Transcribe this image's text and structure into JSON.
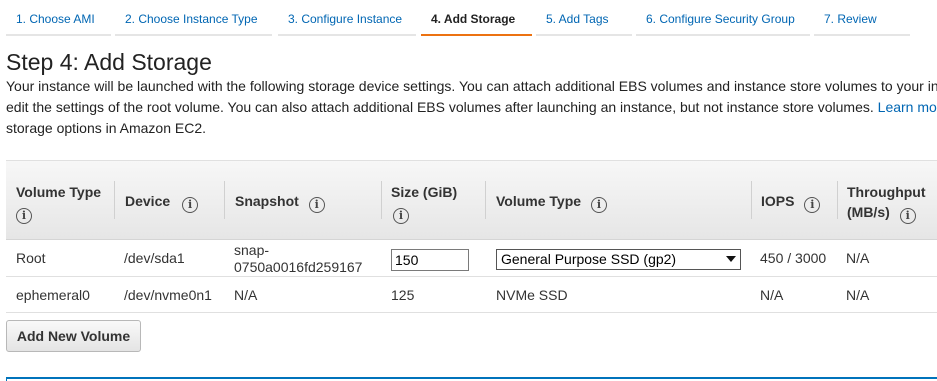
{
  "wizard": {
    "steps": [
      {
        "label": "1. Choose AMI"
      },
      {
        "label": "2. Choose Instance Type"
      },
      {
        "label": "3. Configure Instance"
      },
      {
        "label": "4. Add Storage"
      },
      {
        "label": "5. Add Tags"
      },
      {
        "label": "6. Configure Security Group"
      },
      {
        "label": "7. Review"
      }
    ],
    "active_step": "4. Add Storage"
  },
  "page": {
    "title": "Step 4: Add Storage",
    "description_line1": "Your instance will be launched with the following storage device settings. You can attach additional EBS volumes and instance store volumes to your in",
    "description_line2": "edit the settings of the root volume. You can also attach additional EBS volumes after launching an instance, but not instance store volumes. ",
    "learn_more": "Learn mo",
    "description_line3": "storage options in Amazon EC2."
  },
  "table": {
    "columns": [
      {
        "label_a": "Volume Type",
        "label_b": ""
      },
      {
        "label_a": "Device",
        "label_b": ""
      },
      {
        "label_a": "Snapshot",
        "label_b": ""
      },
      {
        "label_a": "Size (GiB)",
        "label_b": ""
      },
      {
        "label_a": "Volume Type",
        "label_b": ""
      },
      {
        "label_a": "IOPS",
        "label_b": ""
      },
      {
        "label_a": "Throughput",
        "label_b": "(MB/s)"
      }
    ],
    "rows": [
      {
        "volume_type": "Root",
        "device": "/dev/sda1",
        "snapshot_a": "snap-",
        "snapshot_b": "0750a0016fd259167",
        "size": "150",
        "ebs_type": "General Purpose SSD (gp2)",
        "iops": "450 / 3000",
        "throughput": "N/A"
      },
      {
        "volume_type": "ephemeral0",
        "device": "/dev/nvme0n1",
        "snapshot": "N/A",
        "size": "125",
        "ebs_type": "NVMe SSD",
        "iops": "N/A",
        "throughput": "N/A"
      }
    ]
  },
  "actions": {
    "add_volume": "Add New Volume"
  },
  "icons": {
    "info": "info-icon"
  },
  "colors": {
    "link": "#0066b3",
    "active_tab": "#ec7211",
    "accent_bar": "#0073bb"
  }
}
